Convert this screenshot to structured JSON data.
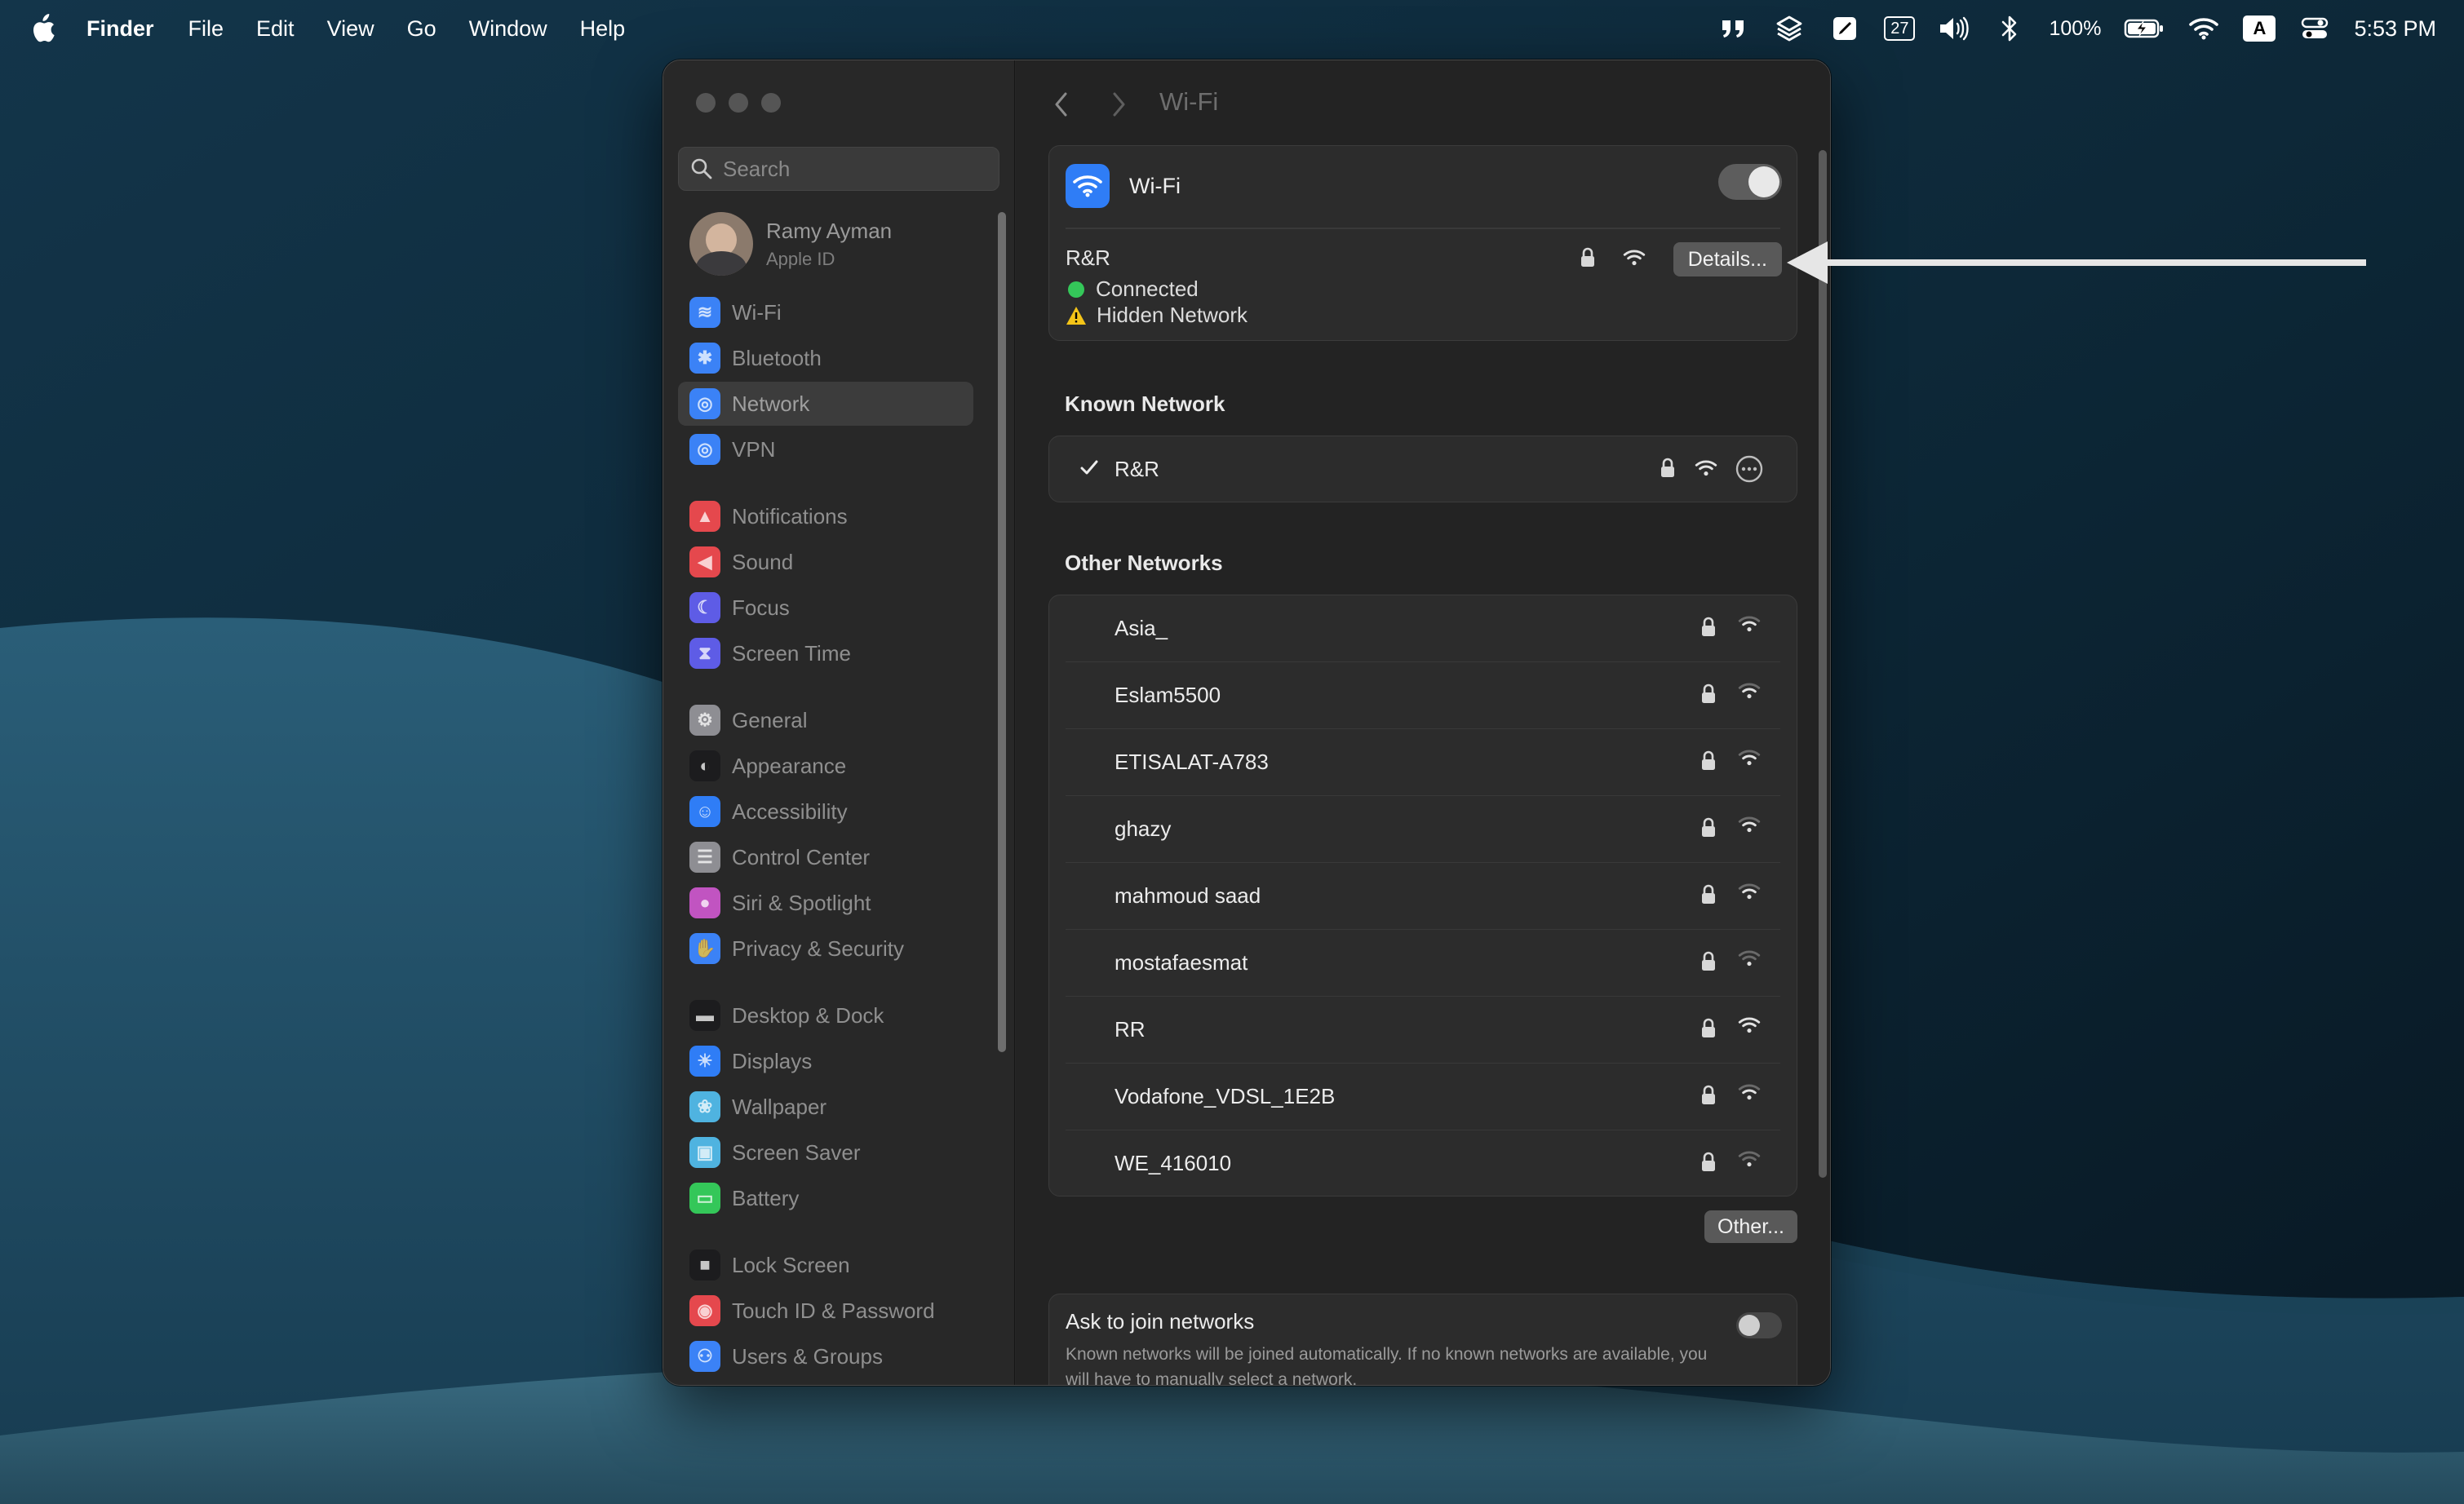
{
  "menubar": {
    "app_name": "Finder",
    "items": [
      "File",
      "Edit",
      "View",
      "Go",
      "Window",
      "Help"
    ],
    "calendar_day": "27",
    "battery_percent": "100%",
    "input_source": "A",
    "clock": "5:53 PM",
    "tray_icons": [
      "quote-icon",
      "layers-icon",
      "notes-icon",
      "calendar-icon",
      "volume-icon",
      "bluetooth-icon",
      "battery-icon",
      "wifi-icon",
      "input-source-icon",
      "control-center-icon"
    ]
  },
  "window": {
    "title": "Wi-Fi",
    "sidebar": {
      "search_placeholder": "Search",
      "profile": {
        "name": "Ramy Ayman",
        "subtitle": "Apple ID"
      },
      "items": [
        {
          "label": "Wi-Fi",
          "icon": "wifi-icon",
          "color": "#3b82f6"
        },
        {
          "label": "Bluetooth",
          "icon": "bluetooth-icon",
          "color": "#3b82f6"
        },
        {
          "label": "Network",
          "icon": "globe-icon",
          "color": "#3b82f6",
          "selected": true
        },
        {
          "label": "VPN",
          "icon": "vpn-globe-icon",
          "color": "#3b82f6"
        },
        {
          "label": "Notifications",
          "icon": "bell-icon",
          "color": "#e5484d"
        },
        {
          "label": "Sound",
          "icon": "speaker-icon",
          "color": "#e5484d"
        },
        {
          "label": "Focus",
          "icon": "moon-icon",
          "color": "#5e5ce6"
        },
        {
          "label": "Screen Time",
          "icon": "hourglass-icon",
          "color": "#5e5ce6"
        },
        {
          "label": "General",
          "icon": "gear-icon",
          "color": "#8e8e93"
        },
        {
          "label": "Appearance",
          "icon": "appearance-icon",
          "color": "#1c1c1e"
        },
        {
          "label": "Accessibility",
          "icon": "accessibility-icon",
          "color": "#2f7df6"
        },
        {
          "label": "Control Center",
          "icon": "control-center-icon",
          "color": "#8e8e93"
        },
        {
          "label": "Siri & Spotlight",
          "icon": "siri-icon",
          "color": "#c154c1"
        },
        {
          "label": "Privacy & Security",
          "icon": "hand-icon",
          "color": "#3b82f6"
        },
        {
          "label": "Desktop & Dock",
          "icon": "dock-icon",
          "color": "#1c1c1e"
        },
        {
          "label": "Displays",
          "icon": "sun-icon",
          "color": "#2f7df6"
        },
        {
          "label": "Wallpaper",
          "icon": "wallpaper-icon",
          "color": "#4fb3e0"
        },
        {
          "label": "Screen Saver",
          "icon": "screen-saver-icon",
          "color": "#4fb3e0"
        },
        {
          "label": "Battery",
          "icon": "battery-icon",
          "color": "#34c759"
        },
        {
          "label": "Lock Screen",
          "icon": "lock-icon",
          "color": "#1c1c1e"
        },
        {
          "label": "Touch ID & Password",
          "icon": "fingerprint-icon",
          "color": "#e5484d"
        },
        {
          "label": "Users & Groups",
          "icon": "users-icon",
          "color": "#3b82f6"
        }
      ]
    },
    "wifi": {
      "label": "Wi-Fi",
      "enabled": true,
      "current_network": "R&R",
      "status": "Connected",
      "warning": "Hidden Network",
      "details_button": "Details..."
    },
    "known_network": {
      "title": "Known Network",
      "items": [
        {
          "name": "R&R",
          "checked": true
        }
      ]
    },
    "other_networks": {
      "title": "Other Networks",
      "items": [
        {
          "name": "Asia_",
          "signal": "strong"
        },
        {
          "name": "Eslam5500",
          "signal": "strong"
        },
        {
          "name": "ETISALAT-A783",
          "signal": "strong"
        },
        {
          "name": "ghazy",
          "signal": "strong"
        },
        {
          "name": "mahmoud saad",
          "signal": "strong"
        },
        {
          "name": "mostafaesmat",
          "signal": "weak"
        },
        {
          "name": "RR",
          "signal": "full"
        },
        {
          "name": "Vodafone_VDSL_1E2B",
          "signal": "strong"
        },
        {
          "name": "WE_416010",
          "signal": "weak"
        }
      ],
      "other_button": "Other..."
    },
    "ask_to_join": {
      "title": "Ask to join networks",
      "enabled": false,
      "description": "Known networks will be joined automatically. If no known networks are available, you will have to manually select a network."
    }
  },
  "colors": {
    "accent": "#2f7df6",
    "connected": "#34c759",
    "warning": "#f5c518",
    "annotation_arrow": "#e6e6e6"
  }
}
